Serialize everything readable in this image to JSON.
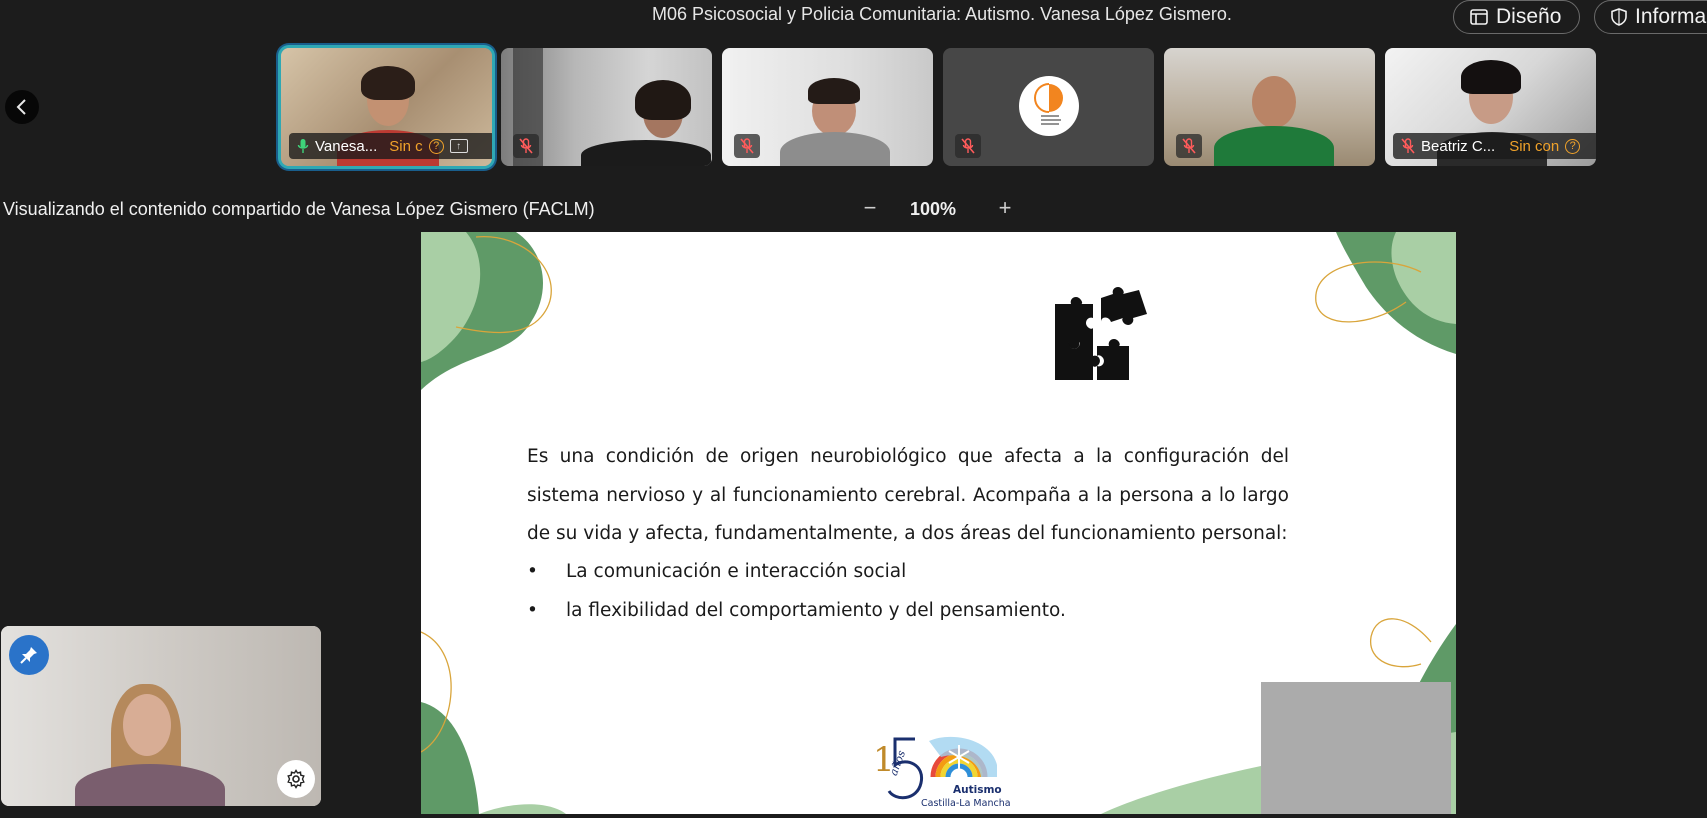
{
  "meeting": {
    "title": "M06 Psicosocial y Policia Comunitaria: Autismo. Vanesa López Gismero."
  },
  "toolbar": {
    "layout_label": "Diseño",
    "info_label": "Informa"
  },
  "participants": [
    {
      "name": "Vanesa...",
      "status": "Sin c",
      "muted": false,
      "speaking": true
    },
    {
      "name": "",
      "muted": true
    },
    {
      "name": "",
      "muted": true
    },
    {
      "name": "",
      "muted": true
    },
    {
      "name": "",
      "muted": true
    },
    {
      "name": "Beatriz C...",
      "status": "Sin con",
      "muted": true
    }
  ],
  "share": {
    "label": "Visualizando el contenido compartido de Vanesa López Gismero (FACLM)",
    "zoom": "100%"
  },
  "slide": {
    "paragraph": "Es una condición de origen neurobiológico que afecta a la configuración del sistema nervioso y al funcionamiento cerebral. Acompaña a la persona a lo largo de su vida y afecta, fundamentalmente, a dos áreas del funcionamiento personal:",
    "bullets": [
      "La comunicación e interacción social",
      "la flexibilidad del comportamiento y del pensamiento."
    ],
    "logo_text": "Autismo",
    "logo_subtext": "Castilla-La Mancha",
    "logo_years": "años"
  },
  "colors": {
    "active_speaker": "#2fa8b4",
    "status_warning": "#f0a22a",
    "slide_green_dark": "#5f9a67",
    "slide_green_light": "#a9cfa5",
    "slide_gold_line": "#d9a53b",
    "pin_blue": "#2a73c9"
  },
  "icons": {
    "layout": "layout-icon",
    "info": "shield-icon",
    "prev": "chevron-left-icon",
    "mic": "mic-icon",
    "mic_off": "mic-off-icon",
    "pin": "pin-icon",
    "settings": "gear-icon",
    "puzzle": "puzzle-icon"
  }
}
